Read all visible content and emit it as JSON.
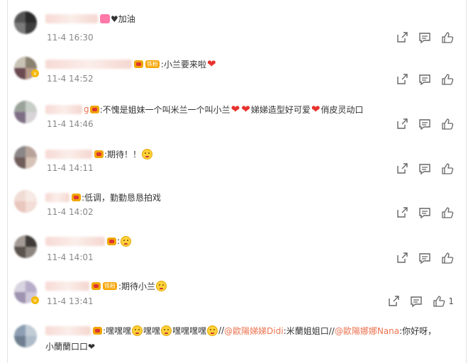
{
  "comments": [
    {
      "text": "♥加油",
      "time": "11-4 16:30",
      "like_count": ""
    },
    {
      "text": ":小兰要来啦",
      "time": "11-4 14:52",
      "like_count": ""
    },
    {
      "name_suffix": "g",
      "text_a": ":不愧是姐妹一个叫米兰一个叫小兰",
      "text_b": "娣娣造型好可爱",
      "text_c": "俏皮灵动口",
      "time": "11-4 14:46",
      "like_count": ""
    },
    {
      "text": ":期待！！",
      "time": "11-4 14:11",
      "like_count": ""
    },
    {
      "text": ":低调，勤勤恳恳拍戏",
      "time": "11-4 14:02",
      "like_count": ""
    },
    {
      "text": ":",
      "time": "11-4 14:01",
      "like_count": ""
    },
    {
      "text": ":期待小兰",
      "time": "11-4 13:41",
      "like_count": "1"
    },
    {
      "seg1": ":嘿嘿嘿",
      "seg2": "嘿嘿",
      "seg3": "嘿嘿嘿嘿",
      "seg4": "//",
      "mention1": "@歐陽娣娣Didi",
      "seg5": ":米蘭姐姐口//",
      "mention2": "@歐陽娜娜Nana",
      "seg6": ":你好呀，",
      "line2": "小蘭蘭口口❤"
    }
  ],
  "badges": {
    "fans": "铁粉"
  },
  "colors": {
    "accent": "#eb7350",
    "heart": "#e8322c",
    "text": "#333333",
    "time": "#888888"
  },
  "icons": [
    "share-icon",
    "comment-icon",
    "like-icon"
  ]
}
